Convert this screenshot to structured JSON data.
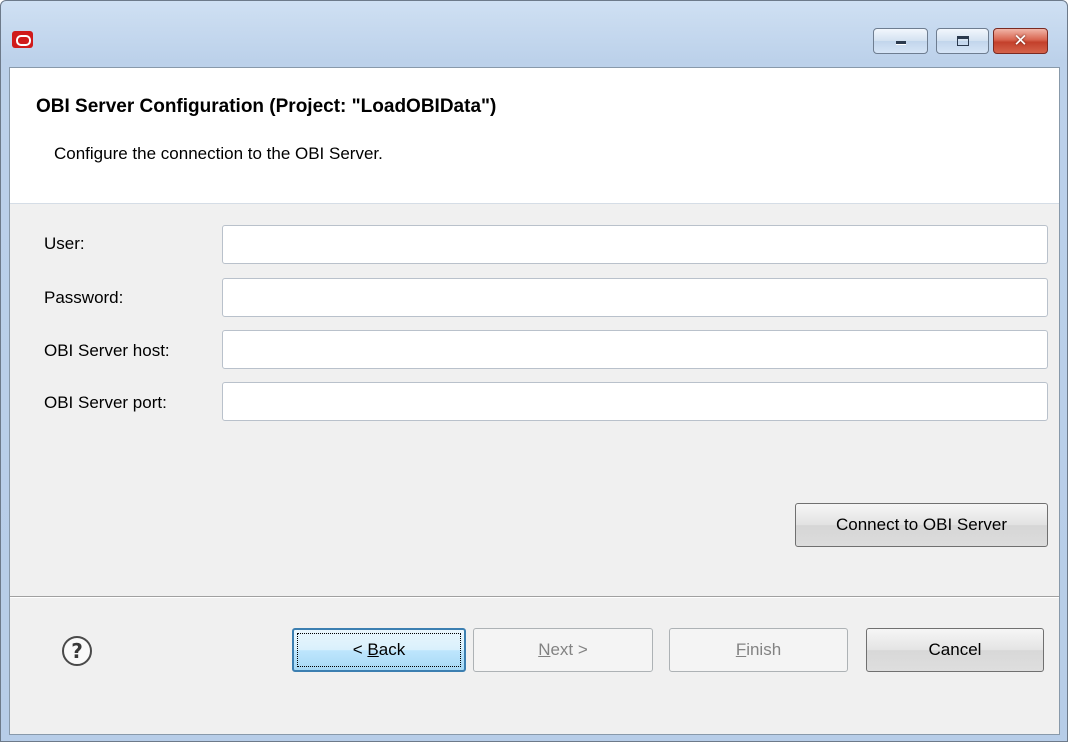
{
  "window": {
    "icon": "oracle-logo-icon",
    "controls": [
      "minimize-icon",
      "maximize-icon",
      "close-icon"
    ]
  },
  "banner": {
    "title": "OBI Server Configuration (Project: \"LoadOBIData\")",
    "description": "Configure the connection to the OBI Server."
  },
  "form": {
    "user_label": "User:",
    "user_value": "",
    "password_label": "Password:",
    "password_value": "",
    "host_label": "OBI Server host:",
    "host_value": "",
    "port_label": "OBI Server port:",
    "port_value": "",
    "connect_label": "Connect to OBI Server"
  },
  "footer": {
    "help_icon": "question-mark-icon",
    "back_mnemonic_prefix": "< ",
    "back_mnemonic": "B",
    "back_rest": "ack",
    "next_mnemonic": "N",
    "next_rest": "ext >",
    "finish_mnemonic": "F",
    "finish_rest": "inish",
    "cancel_label": "Cancel"
  }
}
